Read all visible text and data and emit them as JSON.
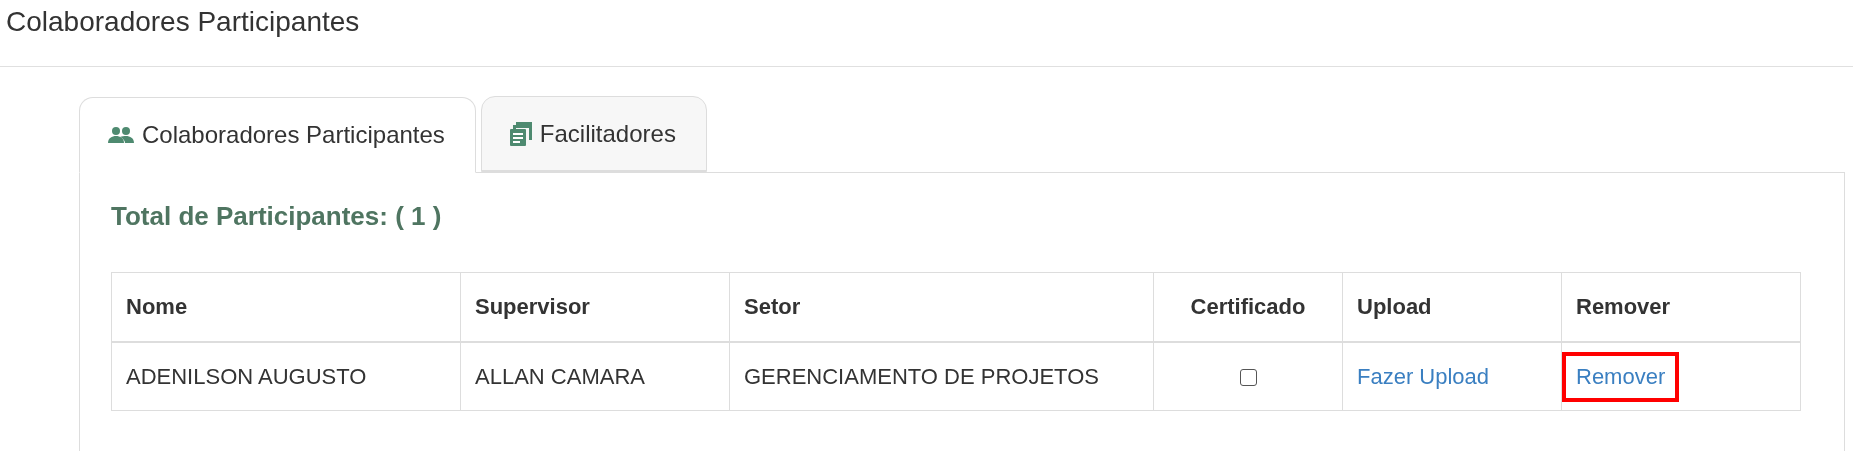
{
  "page_title": "Colaboradores Participantes",
  "tabs": [
    {
      "label": "Colaboradores Participantes",
      "kind": "people",
      "selected": true
    },
    {
      "label": "Facilitadores",
      "kind": "documents",
      "selected": false
    }
  ],
  "total_label": "Total de Participantes: ( 1 )",
  "table": {
    "columns": [
      "Nome",
      "Supervisor",
      "Setor",
      "Certificado",
      "Upload",
      "Remover"
    ],
    "rows": [
      {
        "nome": "ADENILSON AUGUSTO",
        "supervisor": "ALLAN CAMARA",
        "setor": "GERENCIAMENTO DE PROJETOS",
        "certificado": false,
        "upload": "Fazer Upload",
        "remover": "Remover",
        "remover_highlighted": true
      }
    ]
  }
}
